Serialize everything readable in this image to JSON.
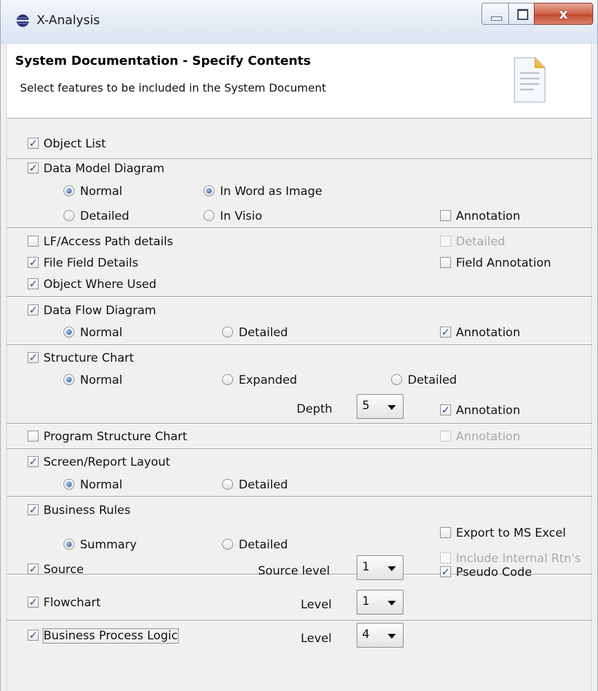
{
  "window": {
    "title": "X-Analysis"
  },
  "header": {
    "title": "System Documentation - Specify Contents",
    "description": "Select features to be included in the System Document"
  },
  "options": {
    "object_list": {
      "label": "Object List",
      "checked": true
    },
    "data_model_diagram": {
      "label": "Data Model Diagram",
      "checked": true,
      "normal": "Normal",
      "detailed": "Detailed",
      "in_word": "In Word as Image",
      "in_visio": "In Visio",
      "annotation": "Annotation",
      "annotation_checked": false
    },
    "lf_access": {
      "label": "LF/Access Path details",
      "checked": false,
      "detailed": "Detailed"
    },
    "file_field_details": {
      "label": "File Field Details",
      "checked": true,
      "field_annotation": "Field Annotation"
    },
    "object_where_used": {
      "label": "Object Where Used",
      "checked": true
    },
    "data_flow_diagram": {
      "label": "Data Flow Diagram",
      "checked": true,
      "normal": "Normal",
      "detailed": "Detailed",
      "annotation": "Annotation",
      "annotation_checked": true
    },
    "structure_chart": {
      "label": "Structure Chart",
      "checked": true,
      "normal": "Normal",
      "expanded": "Expanded",
      "detailed": "Detailed",
      "depth_label": "Depth",
      "depth_value": "5",
      "annotation": "Annotation",
      "annotation_checked": true
    },
    "program_structure_chart": {
      "label": "Program Structure Chart",
      "checked": false,
      "annotation": "Annotation"
    },
    "screen_report_layout": {
      "label": "Screen/Report Layout",
      "checked": true,
      "normal": "Normal",
      "detailed": "Detailed"
    },
    "business_rules": {
      "label": "Business Rules",
      "checked": true,
      "summary": "Summary",
      "detailed": "Detailed",
      "export_excel": "Export to MS Excel",
      "include_internal": "Include Internal Rtn's"
    },
    "source": {
      "label": "Source",
      "checked": true,
      "level_label": "Source level",
      "level_value": "1",
      "pseudo_code": "Pseudo Code",
      "pseudo_code_checked": true
    },
    "flowchart": {
      "label": "Flowchart",
      "checked": true,
      "level_label": "Level",
      "level_value": "1"
    },
    "business_process_logic": {
      "label": "Business Process Logic",
      "checked": true,
      "level_label": "Level",
      "level_value": "4"
    }
  },
  "colors": {
    "title_gradient_top": "#f4f7fb",
    "close_button": "#c24a30",
    "check_mark": "#2a4a8a",
    "radio_dot": "#21519c",
    "dialog_bg": "#f0f0f0"
  },
  "icons": {
    "app": "x-analysis-globe-icon",
    "header": "document-icon"
  }
}
